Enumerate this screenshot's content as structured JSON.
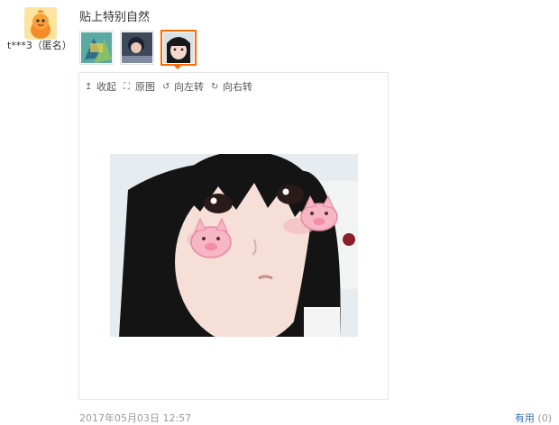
{
  "review": {
    "username": "t***3（匿名）",
    "text": "贴上特别自然",
    "date": "2017年05月03日 12:57",
    "helpful_label": "有用",
    "helpful_count": "(0)"
  },
  "thumbnails": [
    {
      "name": "thumb-1",
      "selected": false
    },
    {
      "name": "thumb-2",
      "selected": false
    },
    {
      "name": "thumb-3",
      "selected": true
    }
  ],
  "toolbar": {
    "collapse": "收起",
    "original": "原图",
    "rotate_left": "向左转",
    "rotate_right": "向右转"
  },
  "colors": {
    "accent": "#ff6a00",
    "link": "#3a6fb7",
    "border": "#e8e0ee"
  },
  "icons": {
    "collapse": "arrow-up-icon",
    "original": "expand-icon",
    "rotate_left": "rotate-left-icon",
    "rotate_right": "rotate-right-icon"
  }
}
